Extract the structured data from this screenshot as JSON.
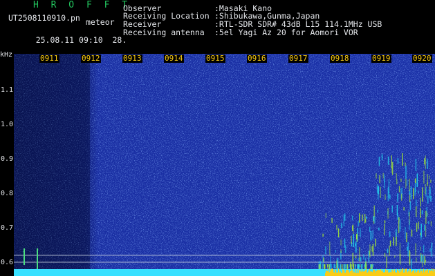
{
  "header": {
    "logo": "H R O F F T",
    "filename": "UT2508110910.pn",
    "meteor_label": "meteor",
    "datetime": "25.08.11 09:10",
    "count": "28.",
    "fields": [
      {
        "label": "Observer",
        "value": ":Masaki Kano"
      },
      {
        "label": "Receiving Location",
        "value": ":Shibukawa,Gunma,Japan"
      },
      {
        "label": "Receiver",
        "value": ":RTL-SDR SDR# 43dB L15 114.1MHz USB"
      },
      {
        "label": "Receiving antenna",
        "value": ":5el Yagi Az 20 for Aomori VOR"
      }
    ]
  },
  "axis": {
    "unit": "kHz",
    "y_ticks": [
      "1.1",
      "1.0",
      "0.9",
      "0.8",
      "0.7",
      "0.6"
    ],
    "x_ticks": [
      "0911",
      "0912",
      "0913",
      "0914",
      "0915",
      "0916",
      "0917",
      "0918",
      "0919",
      "0920"
    ]
  }
}
